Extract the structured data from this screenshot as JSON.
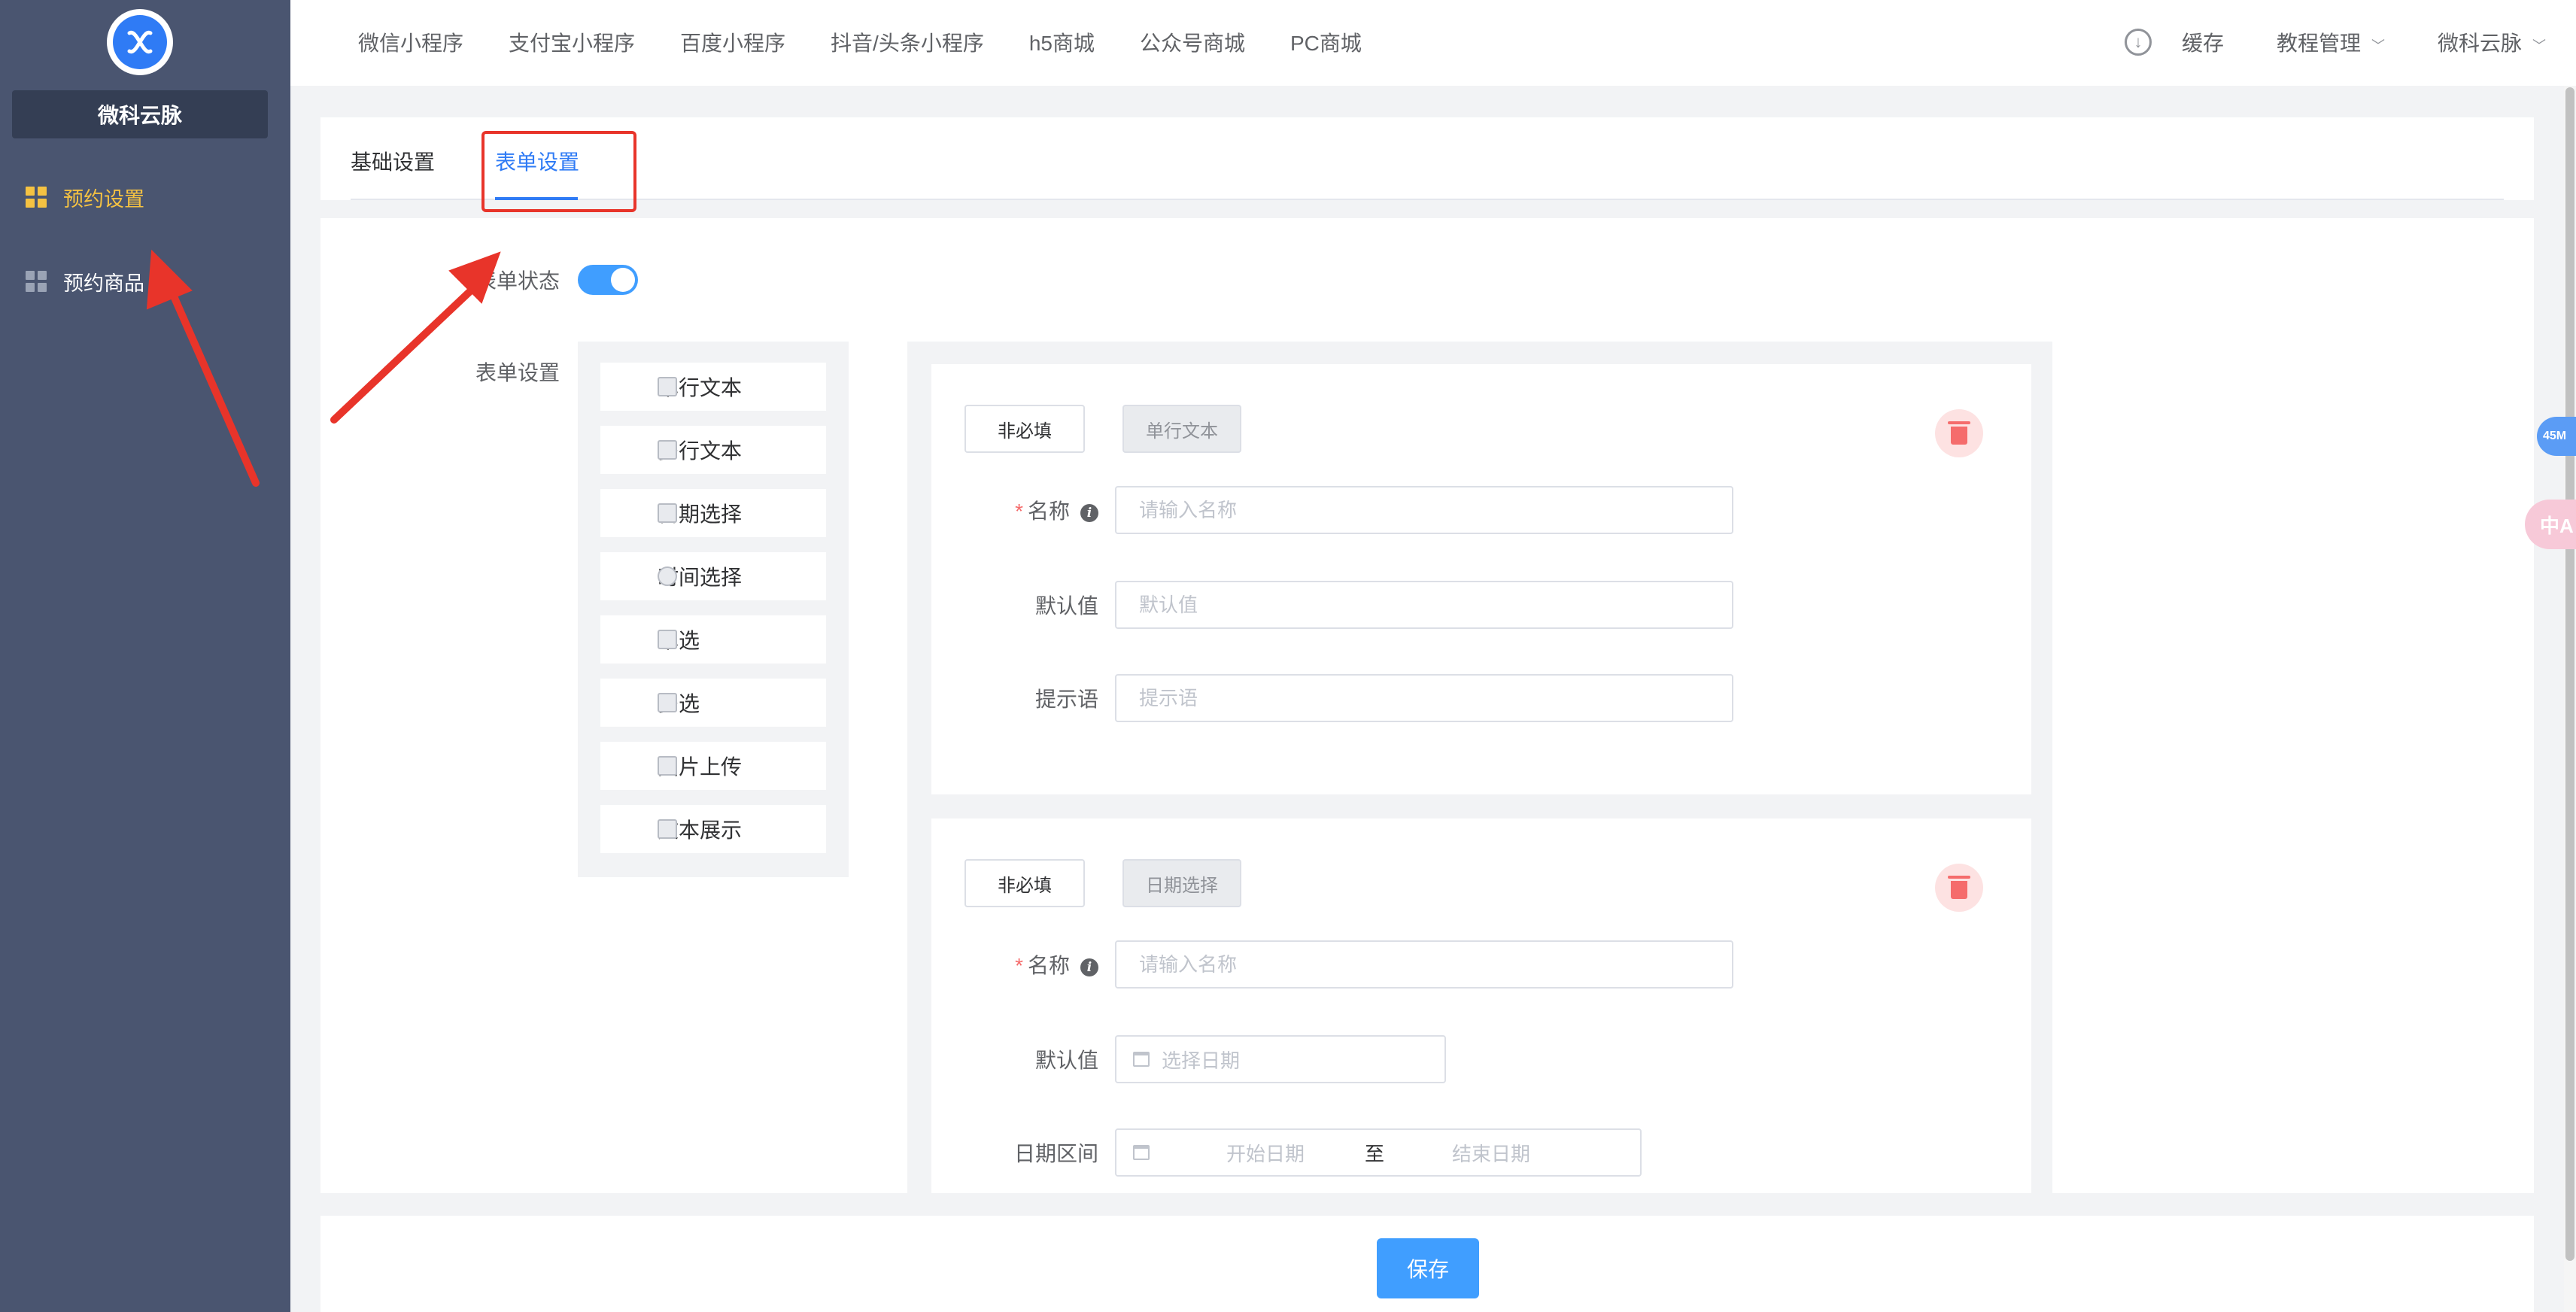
{
  "sidebar": {
    "brand": "微科云脉",
    "items": [
      {
        "label": "预约设置",
        "active": true
      },
      {
        "label": "预约商品",
        "active": false
      }
    ]
  },
  "topnav": {
    "items": [
      "微信小程序",
      "支付宝小程序",
      "百度小程序",
      "抖音/头条小程序",
      "h5商城",
      "公众号商城",
      "PC商城"
    ],
    "cache": "缓存",
    "tutorial": "教程管理",
    "user": "微科云脉"
  },
  "tabs": [
    {
      "label": "基础设置",
      "active": false
    },
    {
      "label": "表单设置",
      "active": true
    }
  ],
  "form": {
    "status_label": "表单状态",
    "settings_label": "表单设置",
    "status_on": true
  },
  "palette": [
    "单行文本",
    "多行文本",
    "日期选择",
    "时间选择",
    "单选",
    "多选",
    "图片上传",
    "文本展示"
  ],
  "fields": [
    {
      "required_tag": "非必填",
      "type_tag": "单行文本",
      "name_label": "名称",
      "name_placeholder": "请输入名称",
      "default_label": "默认值",
      "default_placeholder": "默认值",
      "hint_label": "提示语",
      "hint_placeholder": "提示语"
    },
    {
      "required_tag": "非必填",
      "type_tag": "日期选择",
      "name_label": "名称",
      "name_placeholder": "请输入名称",
      "default_label": "默认值",
      "default_placeholder": "选择日期",
      "range_label": "日期区间",
      "range_start": "开始日期",
      "range_sep": "至",
      "range_end": "结束日期"
    }
  ],
  "save_label": "保存",
  "floating": {
    "memory": "45M",
    "translate": "中A"
  },
  "colors": {
    "sidebar": "#4a5570",
    "accent": "#409eff",
    "active_menu": "#f5c242",
    "annotation": "#e8342a"
  }
}
